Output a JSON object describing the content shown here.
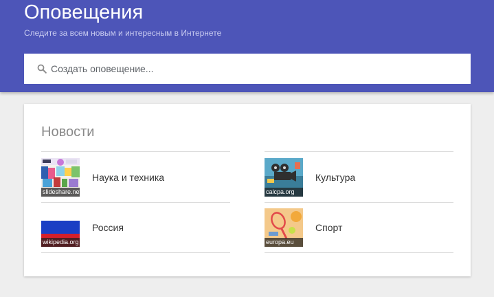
{
  "header": {
    "title": "Оповещения",
    "subtitle": "Следите за всем новым и интересным в Интернете",
    "background": "#4d55b8"
  },
  "search": {
    "placeholder": "Создать оповещение...",
    "icon": "search-icon"
  },
  "news": {
    "title": "Новости",
    "left": [
      {
        "label": "Наука и техника",
        "source": "slideshare.net"
      },
      {
        "label": "Россия",
        "source": "wikipedia.org"
      }
    ],
    "right": [
      {
        "label": "Культура",
        "source": "calcpa.org"
      },
      {
        "label": "Спорт",
        "source": "europa.eu"
      }
    ]
  }
}
